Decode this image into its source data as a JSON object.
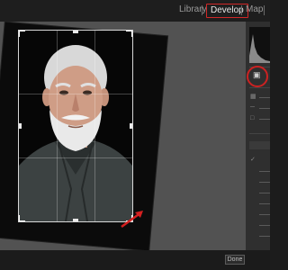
{
  "modules": {
    "library": "Library",
    "develop": "Develop",
    "map": "Map"
  },
  "toolbar": {
    "done_label": "Done"
  },
  "colors": {
    "highlight": "#cc2222",
    "panel": "#2f2f2f",
    "background": "#525252"
  },
  "icons": {
    "crop_tool": "crop-overlay-icon",
    "arrow": "red-arrow-icon"
  }
}
